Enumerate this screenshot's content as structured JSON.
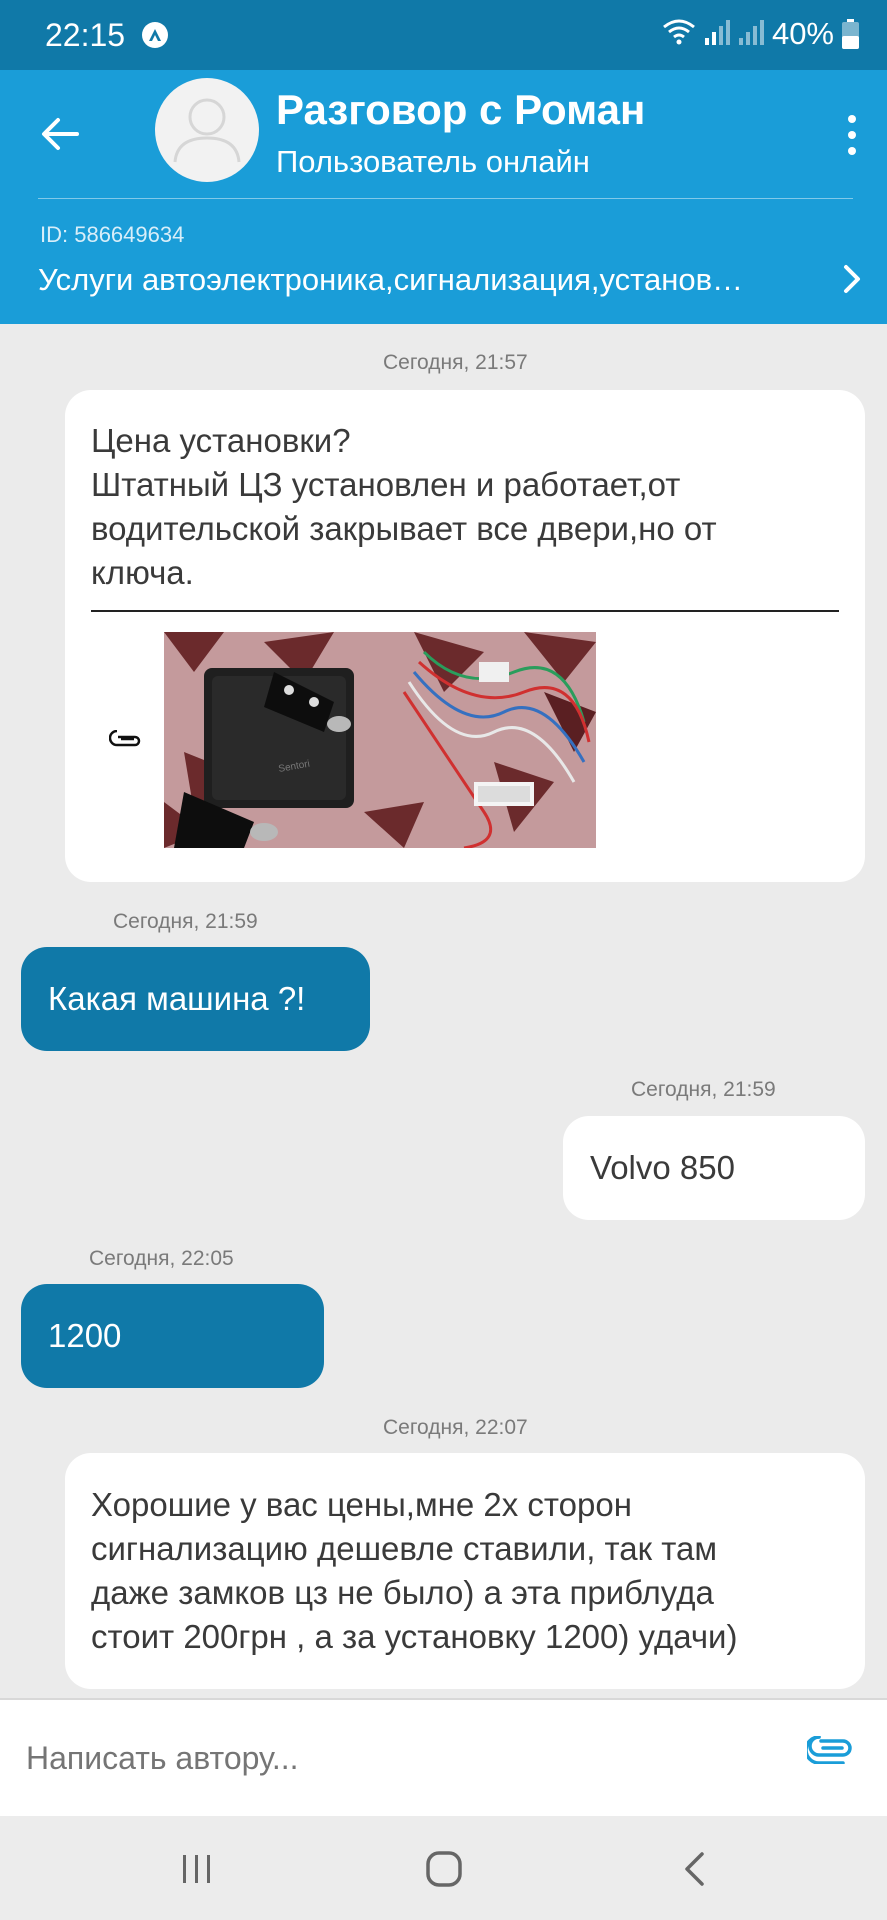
{
  "status_bar": {
    "time": "22:15",
    "battery": "40%",
    "icons": [
      "app-a-icon",
      "wifi-icon",
      "signal-icon",
      "signal-icon",
      "battery-icon"
    ]
  },
  "header": {
    "title": "Разговор с Роман",
    "subtitle": "Пользователь онлайн",
    "ad_id": "ID: 586649634",
    "ad_title": "Услуги автоэлектроника,сигнализация,установ…"
  },
  "messages": [
    {
      "time": "Сегодня, 21:57",
      "direction": "incoming",
      "text_lines": [
        "Цена установки?",
        "Штатный ЦЗ установлен и работает,от",
        "водительской закрывает все двери,но от",
        "ключа."
      ],
      "has_attachment": true
    },
    {
      "time": "Сегодня, 21:59",
      "direction": "outgoing",
      "text": "Какая машина ?!"
    },
    {
      "time": "Сегодня, 21:59",
      "direction": "incoming",
      "text": "Volvo 850"
    },
    {
      "time": "Сегодня, 22:05",
      "direction": "outgoing",
      "text": "1200"
    },
    {
      "time": "Сегодня, 22:07",
      "direction": "incoming",
      "text_lines": [
        "Хорошие у вас цены,мне 2х сторон",
        "сигнализацию дешевле ставили, так там",
        "даже замков цз не было) а эта приблуда",
        "стоит 200грн , а за установку 1200) удачи)"
      ]
    }
  ],
  "input": {
    "placeholder": "Написать автору..."
  },
  "colors": {
    "status_bar": "#1079a8",
    "header": "#1a9dd8",
    "outgoing_bubble": "#1079a8",
    "incoming_bubble": "#ffffff",
    "background": "#ebebeb"
  }
}
